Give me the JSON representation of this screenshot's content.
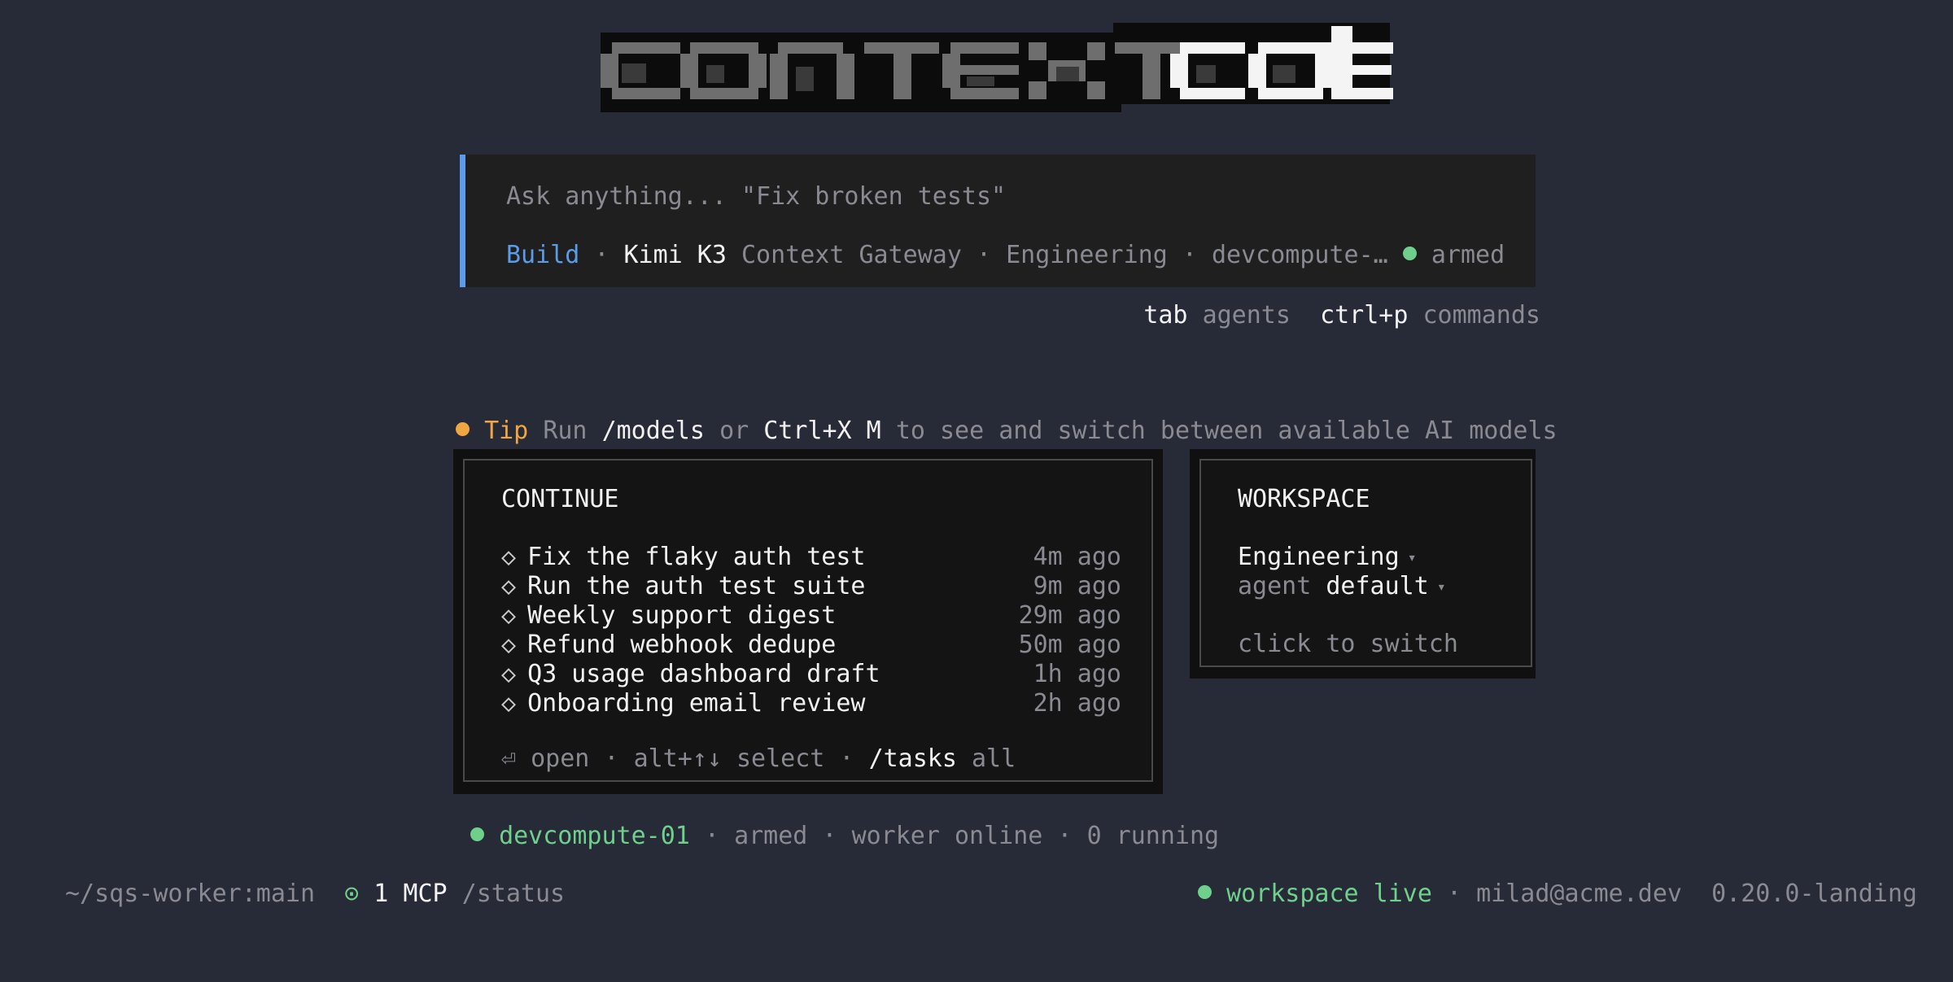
{
  "logo": {
    "text_part1": "context",
    "text_part2": "code"
  },
  "prompt": {
    "placeholder": "Ask anything... \"Fix broken tests\"",
    "mode": "Build",
    "model": "Kimi K3",
    "gateway": "Context Gateway",
    "workspace": "Engineering",
    "machine": "devcompute-…",
    "state": "armed",
    "separator": " · "
  },
  "hints": {
    "key1": "tab",
    "label1": "agents",
    "key2": "ctrl+p",
    "label2": "commands"
  },
  "tip": {
    "label": "Tip",
    "run": "Run",
    "command": "/models",
    "or": "or",
    "shortcut": "Ctrl+X M",
    "rest": "to see and switch between available AI models"
  },
  "continue": {
    "title": "CONTINUE",
    "tasks": [
      {
        "name": "Fix the flaky auth test",
        "age": "4m ago"
      },
      {
        "name": "Run the auth test suite",
        "age": "9m ago"
      },
      {
        "name": "Weekly support digest",
        "age": "29m ago"
      },
      {
        "name": "Refund webhook dedupe",
        "age": "50m ago"
      },
      {
        "name": "Q3 usage dashboard draft",
        "age": "1h ago"
      },
      {
        "name": "Onboarding email review",
        "age": "2h ago"
      }
    ],
    "footer": {
      "open_glyph": "⏎",
      "open": "open",
      "select_key": "alt+↑↓",
      "select": "select",
      "tasks_cmd": "/tasks",
      "tasks_label": "all",
      "separator": " · "
    }
  },
  "workspace": {
    "title": "WORKSPACE",
    "name": "Engineering",
    "agent_label": "agent",
    "agent_value": "default",
    "switch_label": "click to switch"
  },
  "status": {
    "machine": "devcompute-01",
    "state": "armed",
    "worker": "worker online",
    "running": "0 running",
    "separator": " · "
  },
  "footer": {
    "path": "~/sqs-worker:main",
    "mcp_icon": "⊙",
    "mcp_count": "1 MCP",
    "status_cmd": "/status",
    "workspace_state": "workspace live",
    "user": "milad@acme.dev",
    "version": "0.20.0-landing",
    "separator": " · "
  },
  "colors": {
    "background": "#272a37",
    "accent_blue": "#5b9be8",
    "status_green": "#6fd08c",
    "tip_orange": "#f0a642"
  }
}
